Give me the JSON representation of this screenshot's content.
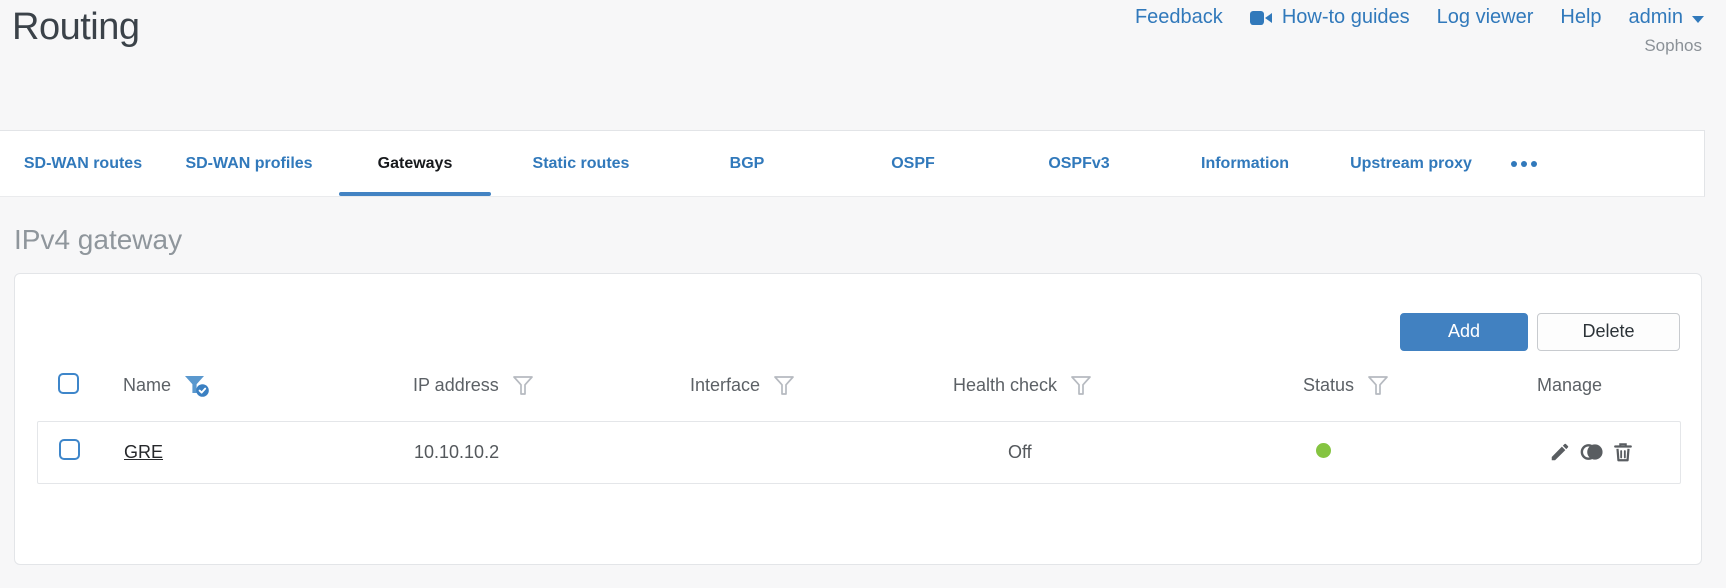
{
  "page": {
    "title": "Routing"
  },
  "header": {
    "links": [
      {
        "label": "Feedback"
      },
      {
        "label": "How-to guides",
        "icon": "video-camera-icon"
      },
      {
        "label": "Log viewer"
      },
      {
        "label": "Help"
      }
    ],
    "user_menu": {
      "label": "admin",
      "icon": "chevron-down-icon"
    },
    "brand": "Sophos"
  },
  "tabs": {
    "items": [
      "SD-WAN routes",
      "SD-WAN profiles",
      "Gateways",
      "Static routes",
      "BGP",
      "OSPF",
      "OSPFv3",
      "Information",
      "Upstream proxy"
    ],
    "active": "Gateways",
    "more_icon": "ellipsis-icon"
  },
  "section": {
    "title": "IPv4 gateway"
  },
  "toolbar": {
    "add_label": "Add",
    "delete_label": "Delete"
  },
  "table": {
    "columns": [
      {
        "label": "Name",
        "filter_icon": "filter-funnel-icon",
        "filter_state": "active"
      },
      {
        "label": "IP address",
        "filter_icon": "filter-funnel-icon",
        "filter_state": "inactive"
      },
      {
        "label": "Interface",
        "filter_icon": "filter-funnel-icon",
        "filter_state": "inactive"
      },
      {
        "label": "Health check",
        "filter_icon": "filter-funnel-icon",
        "filter_state": "inactive"
      },
      {
        "label": "Status",
        "filter_icon": "filter-funnel-icon",
        "filter_state": "inactive"
      },
      {
        "label": "Manage"
      }
    ],
    "rows": [
      {
        "name": "GRE",
        "ip_address": "10.10.10.2",
        "interface": "",
        "health_check": "Off",
        "status": "up",
        "status_color": "#85c441",
        "manage_icons": [
          "edit-icon",
          "clone-icon",
          "delete-icon"
        ]
      }
    ]
  },
  "colors": {
    "accent_blue": "#3179bb",
    "active_tab_underline": "#4383c3",
    "add_button_blue": "#4181c1",
    "status_green": "#85c441",
    "page_background": "#f7f7f8"
  }
}
